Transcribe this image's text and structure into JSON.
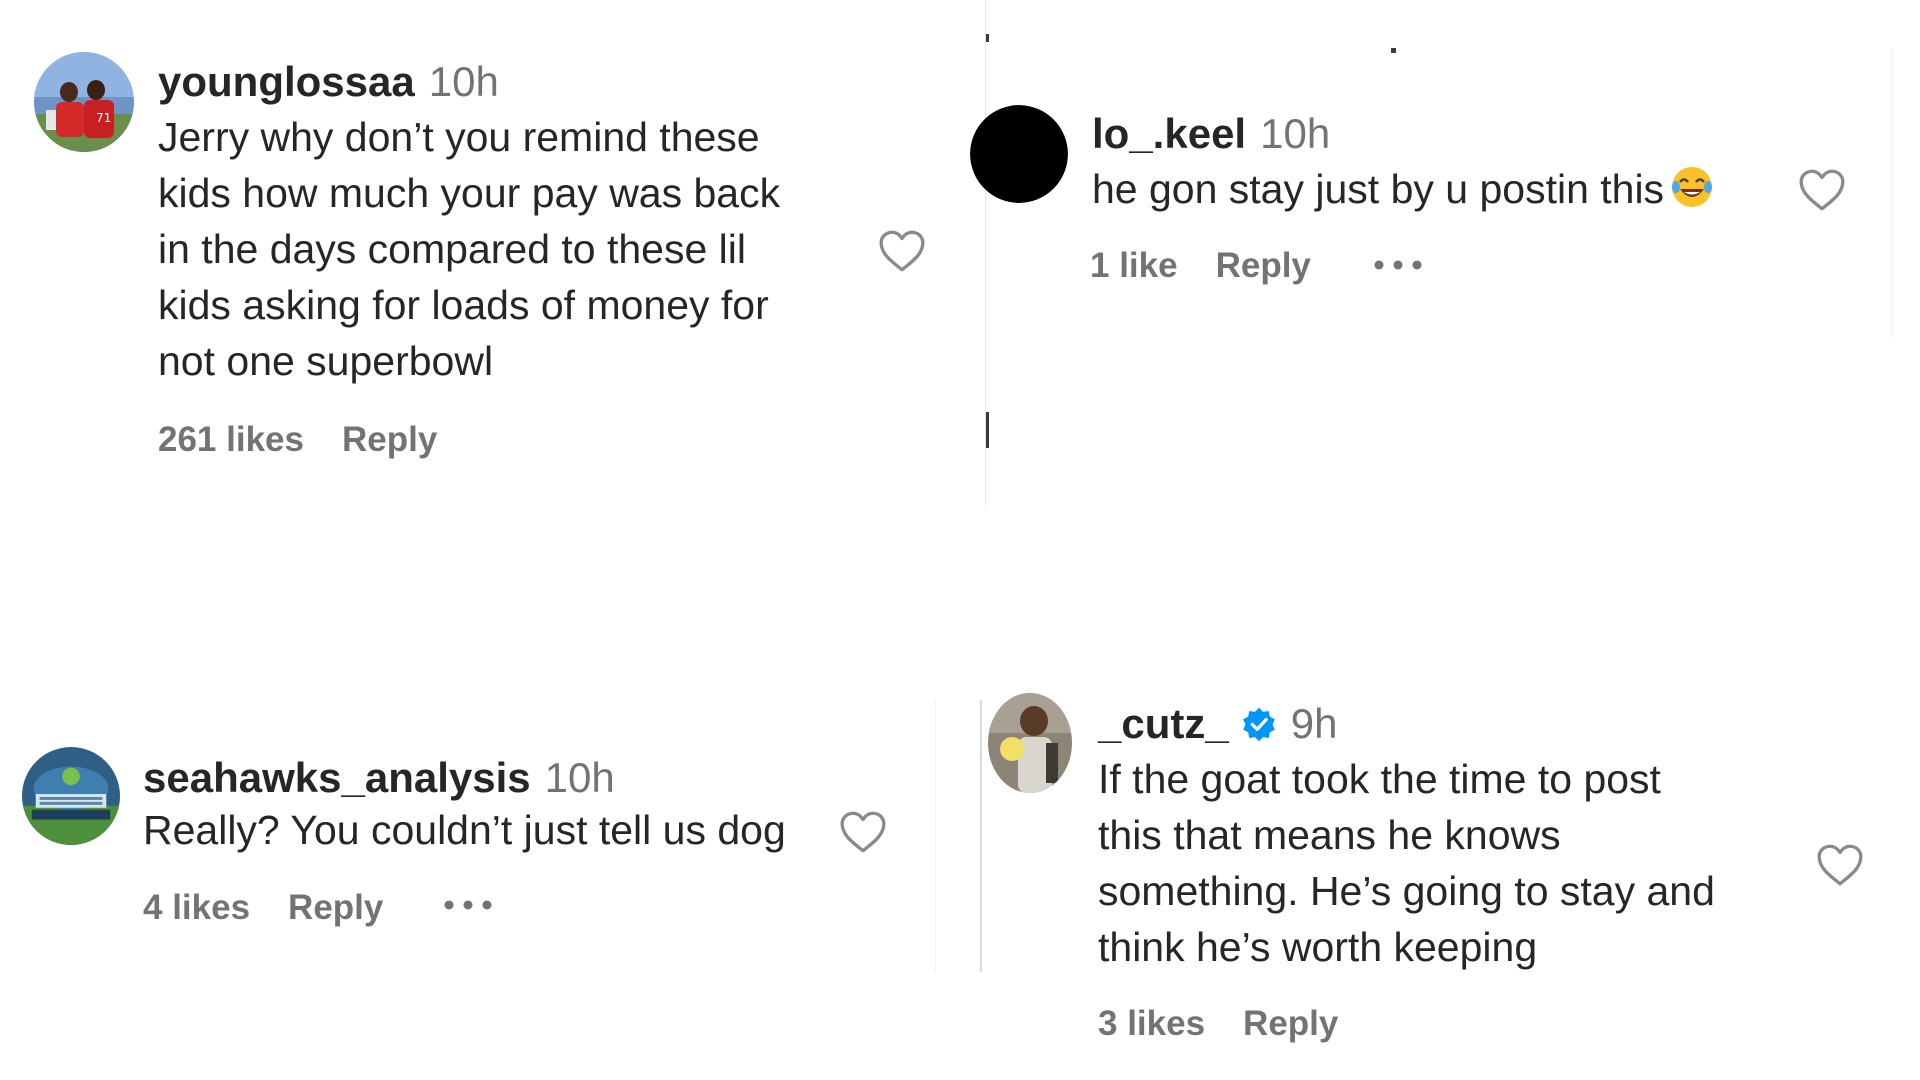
{
  "colors": {
    "text": "#262626",
    "secondary": "#737373",
    "verified_badge": "#0095f6",
    "background": "#ffffff"
  },
  "comments": [
    {
      "username": "younglossaa",
      "time": "10h",
      "verified": false,
      "lines": [
        "Jerry why don’t you remind these",
        "kids how much your pay was back",
        "in the days compared to these lil",
        "kids asking for loads of money for",
        "not one superbowl"
      ],
      "likes": "261 likes",
      "reply": "Reply",
      "avatar_icon": "avatar-photo-football-players",
      "like_icon": "heart-outline-icon",
      "has_more_menu": false
    },
    {
      "username": "lo_.keel",
      "time": "10h",
      "verified": false,
      "text": "he gon stay just by u postin this",
      "text_emoji": "laughing-crying-emoji",
      "likes": "1 like",
      "reply": "Reply",
      "avatar_icon": "avatar-black-circle",
      "like_icon": "heart-outline-icon",
      "has_more_menu": true
    },
    {
      "username": "seahawks_analysis",
      "time": "10h",
      "verified": false,
      "text": "Really? You couldn’t just tell us dog",
      "likes": "4 likes",
      "reply": "Reply",
      "avatar_icon": "avatar-seahawks-logo",
      "like_icon": "heart-outline-icon",
      "has_more_menu": true
    },
    {
      "username": "_cutz_",
      "time": "9h",
      "verified": true,
      "lines": [
        "If the goat took the time to post",
        "this that means he knows",
        "something. He’s going to stay and",
        "think he’s worth keeping"
      ],
      "likes": "3 likes",
      "reply": "Reply",
      "avatar_icon": "avatar-photo-person",
      "like_icon": "heart-outline-icon",
      "has_more_menu": false
    }
  ]
}
